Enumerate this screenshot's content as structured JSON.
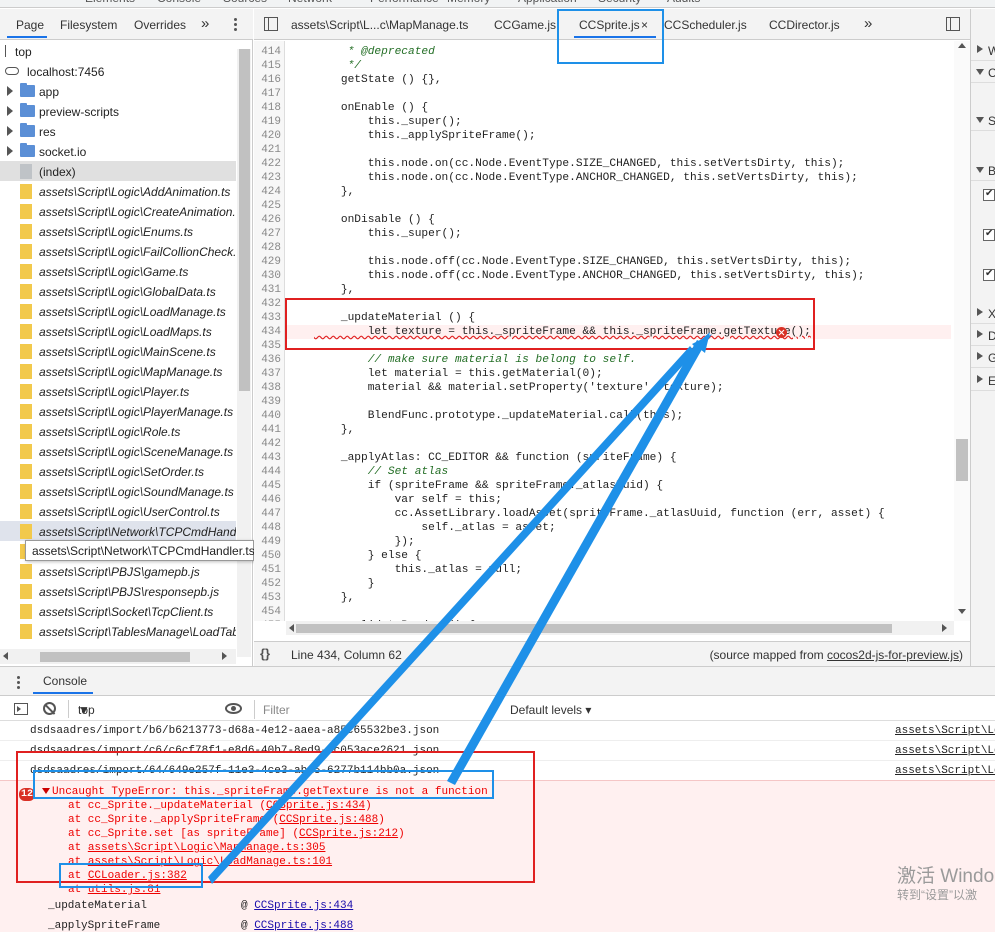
{
  "top_strip": [
    "Elements",
    "Console",
    "Sources",
    "Network",
    "Performance",
    "Memory",
    "Application",
    "Security",
    "Audits"
  ],
  "navigator": {
    "tabs": [
      "Page",
      "Filesystem",
      "Overrides"
    ],
    "more": "»",
    "tree": [
      {
        "label": "top",
        "kind": "frame"
      },
      {
        "label": "localhost:7456",
        "kind": "cloud"
      },
      {
        "label": "app",
        "kind": "folder"
      },
      {
        "label": "preview-scripts",
        "kind": "folder"
      },
      {
        "label": "res",
        "kind": "folder"
      },
      {
        "label": "socket.io",
        "kind": "folder"
      },
      {
        "label": "(index)",
        "kind": "index"
      },
      {
        "label": "assets\\Script\\Logic\\AddAnimation.ts",
        "kind": "file"
      },
      {
        "label": "assets\\Script\\Logic\\CreateAnimation.ts",
        "kind": "file"
      },
      {
        "label": "assets\\Script\\Logic\\Enums.ts",
        "kind": "file"
      },
      {
        "label": "assets\\Script\\Logic\\FailCollionCheck.ts",
        "kind": "file"
      },
      {
        "label": "assets\\Script\\Logic\\Game.ts",
        "kind": "file"
      },
      {
        "label": "assets\\Script\\Logic\\GlobalData.ts",
        "kind": "file"
      },
      {
        "label": "assets\\Script\\Logic\\LoadManage.ts",
        "kind": "file"
      },
      {
        "label": "assets\\Script\\Logic\\LoadMaps.ts",
        "kind": "file"
      },
      {
        "label": "assets\\Script\\Logic\\MainScene.ts",
        "kind": "file"
      },
      {
        "label": "assets\\Script\\Logic\\MapManage.ts",
        "kind": "file"
      },
      {
        "label": "assets\\Script\\Logic\\Player.ts",
        "kind": "file"
      },
      {
        "label": "assets\\Script\\Logic\\PlayerManage.ts",
        "kind": "file"
      },
      {
        "label": "assets\\Script\\Logic\\Role.ts",
        "kind": "file"
      },
      {
        "label": "assets\\Script\\Logic\\SceneManage.ts",
        "kind": "file"
      },
      {
        "label": "assets\\Script\\Logic\\SetOrder.ts",
        "kind": "file"
      },
      {
        "label": "assets\\Script\\Logic\\SoundManage.ts",
        "kind": "file"
      },
      {
        "label": "assets\\Script\\Logic\\UserControl.ts",
        "kind": "file"
      },
      {
        "label": "assets\\Script\\Network\\TCPCmdHandle",
        "kind": "file"
      },
      {
        "label": "",
        "kind": "file"
      },
      {
        "label": "assets\\Script\\PBJS\\gamepb.js",
        "kind": "file"
      },
      {
        "label": "assets\\Script\\PBJS\\responsepb.js",
        "kind": "file"
      },
      {
        "label": "assets\\Script\\Socket\\TcpClient.ts",
        "kind": "file"
      },
      {
        "label": "assets\\Script\\TablesManage\\LoadTabl",
        "kind": "file"
      }
    ],
    "tooltip": "assets\\Script\\Network\\TCPCmdHandler.ts (from source map)"
  },
  "editor": {
    "tabs": [
      "assets\\Script\\L...c\\MapManage.ts",
      "CCGame.js",
      "CCSprite.js",
      "CCScheduler.js",
      "CCDirector.js"
    ],
    "active_tab_close": "×",
    "more": "»",
    "status": {
      "format": "{}",
      "position": "Line 434, Column 62",
      "source_prefix": "(source mapped from ",
      "source_link": "cocos2d-js-for-preview.js",
      "source_suffix": ")"
    }
  },
  "code_lines": [
    {
      "n": "414",
      "t": "     * @deprecated",
      "c": "cm"
    },
    {
      "n": "415",
      "t": "     */",
      "c": "cm"
    },
    {
      "n": "416",
      "t": "    getState () {},",
      "c": "plain"
    },
    {
      "n": "417",
      "t": "",
      "c": "plain"
    },
    {
      "n": "418",
      "t": "    onEnable () {",
      "c": "plain"
    },
    {
      "n": "419",
      "t": "        this._super();",
      "c": "plain"
    },
    {
      "n": "420",
      "t": "        this._applySpriteFrame();",
      "c": "plain"
    },
    {
      "n": "421",
      "t": "",
      "c": "plain"
    },
    {
      "n": "422",
      "t": "        this.node.on(cc.Node.EventType.SIZE_CHANGED, this.setVertsDirty, this);",
      "c": "plain"
    },
    {
      "n": "423",
      "t": "        this.node.on(cc.Node.EventType.ANCHOR_CHANGED, this.setVertsDirty, this);",
      "c": "plain"
    },
    {
      "n": "424",
      "t": "    },",
      "c": "plain"
    },
    {
      "n": "425",
      "t": "",
      "c": "plain"
    },
    {
      "n": "426",
      "t": "    onDisable () {",
      "c": "plain"
    },
    {
      "n": "427",
      "t": "        this._super();",
      "c": "plain"
    },
    {
      "n": "428",
      "t": "",
      "c": "plain"
    },
    {
      "n": "429",
      "t": "        this.node.off(cc.Node.EventType.SIZE_CHANGED, this.setVertsDirty, this);",
      "c": "plain"
    },
    {
      "n": "430",
      "t": "        this.node.off(cc.Node.EventType.ANCHOR_CHANGED, this.setVertsDirty, this);",
      "c": "plain"
    },
    {
      "n": "431",
      "t": "    },",
      "c": "plain"
    },
    {
      "n": "432",
      "t": "",
      "c": "plain"
    },
    {
      "n": "433",
      "t": "    _updateMaterial () {",
      "c": "plain"
    },
    {
      "n": "434",
      "t": "        let texture = this._spriteFrame && this._spriteFrame.getTexture();",
      "c": "plain"
    },
    {
      "n": "435",
      "t": "",
      "c": "plain"
    },
    {
      "n": "436",
      "t": "        // make sure material is belong to self.",
      "c": "cm"
    },
    {
      "n": "437",
      "t": "        let material = this.getMaterial(0);",
      "c": "plain"
    },
    {
      "n": "438",
      "t": "        material && material.setProperty('texture', texture);",
      "c": "plain"
    },
    {
      "n": "439",
      "t": "",
      "c": "plain"
    },
    {
      "n": "440",
      "t": "        BlendFunc.prototype._updateMaterial.call(this);",
      "c": "plain"
    },
    {
      "n": "441",
      "t": "    },",
      "c": "plain"
    },
    {
      "n": "442",
      "t": "",
      "c": "plain"
    },
    {
      "n": "443",
      "t": "    _applyAtlas: CC_EDITOR && function (spriteFrame) {",
      "c": "plain"
    },
    {
      "n": "444",
      "t": "        // Set atlas",
      "c": "cm"
    },
    {
      "n": "445",
      "t": "        if (spriteFrame && spriteFrame._atlasUuid) {",
      "c": "plain"
    },
    {
      "n": "446",
      "t": "            var self = this;",
      "c": "plain"
    },
    {
      "n": "447",
      "t": "            cc.AssetLibrary.loadAsset(spriteFrame._atlasUuid, function (err, asset) {",
      "c": "plain"
    },
    {
      "n": "448",
      "t": "                self._atlas = asset;",
      "c": "plain"
    },
    {
      "n": "449",
      "t": "            });",
      "c": "plain"
    },
    {
      "n": "450",
      "t": "        } else {",
      "c": "plain"
    },
    {
      "n": "451",
      "t": "            this._atlas = null;",
      "c": "plain"
    },
    {
      "n": "452",
      "t": "        }",
      "c": "plain"
    },
    {
      "n": "453",
      "t": "    },",
      "c": "plain"
    },
    {
      "n": "454",
      "t": "",
      "c": "plain"
    },
    {
      "n": "455",
      "t": "    _validateRender () {",
      "c": "plain"
    },
    {
      "n": "456",
      "t": "",
      "c": "plain"
    }
  ],
  "right_panel": [
    "W",
    "C",
    "Sc",
    "B",
    "X",
    "D",
    "G",
    "Ev"
  ],
  "console": {
    "tab": "Console",
    "context": "top",
    "filter_placeholder": "Filter",
    "levels": "Default levels ▾",
    "messages": [
      {
        "text": "dsdsaadres/import/b6/b6213773-d68a-4e12-aaea-a85c65532be3.json",
        "src": "assets\\Script\\Lo"
      },
      {
        "text": "dsdsaadres/import/c6/c6cf78f1-e8d6-40b7-8ed9-4c053ace2621.json",
        "src": "assets\\Script\\Lo"
      },
      {
        "text": "dsdsaadres/import/64/649e257f-11e3-4ce3-aba5-6277b114bb0a.json",
        "src": "assets\\Script\\Lo"
      }
    ],
    "error": {
      "count": "12",
      "message": "Uncaught TypeError: this._spriteFrame.getTexture is not a function",
      "stack": [
        {
          "pre": "at cc_Sprite._updateMaterial (",
          "link": "CCSprite.js:434",
          "post": ")"
        },
        {
          "pre": "at cc_Sprite._applySpriteFrame (",
          "link": "CCSprite.js:488",
          "post": ")"
        },
        {
          "pre": "at cc_Sprite.set [as spriteFrame] (",
          "link": "CCSprite.js:212",
          "post": ")"
        },
        {
          "pre": "at ",
          "link": "assets\\Script\\Logic\\MapManage.ts:305",
          "post": ""
        },
        {
          "pre": "at ",
          "link": "assets\\Script\\Logic\\LoadManage.ts:101",
          "post": ""
        },
        {
          "pre": "at ",
          "link": "CCLoader.js:382",
          "post": ""
        },
        {
          "pre": "at ",
          "link": "utils.js:81",
          "post": ""
        }
      ],
      "call_frames": [
        {
          "fn": "_updateMaterial",
          "at": "@ ",
          "link": "CCSprite.js:434"
        },
        {
          "fn": "_applySpriteFrame",
          "at": "@ ",
          "link": "CCSprite.js:488"
        }
      ]
    }
  },
  "watermark": {
    "line1": "激活 Windo",
    "line2": "转到“设置”以激"
  },
  "colors": {
    "accent": "#1a73e8",
    "annotation_red": "#e02020",
    "annotation_blue": "#1e90e8",
    "error_bg": "#fff0f0",
    "error_text": "#e00000"
  }
}
